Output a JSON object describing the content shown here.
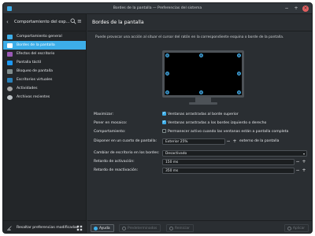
{
  "window": {
    "title": "Bordes de la pantalla — Preferencias del sistema"
  },
  "colors": {
    "accent": "#3daee9",
    "background": "#2a2e32",
    "sidebar": "#232629",
    "text": "#e6e8eb"
  },
  "sidebar": {
    "title": "Comportamiento del esp...",
    "items": [
      {
        "label": "Comportamiento general",
        "icon": "general-behavior-icon"
      },
      {
        "label": "Bordes de la pantalla",
        "icon": "screen-edges-icon",
        "active": true
      },
      {
        "label": "Efectos del escritorio",
        "icon": "desktop-effects-icon"
      },
      {
        "label": "Pantalla táctil",
        "icon": "touchscreen-icon"
      },
      {
        "label": "Bloqueo de pantalla",
        "icon": "lock-icon"
      },
      {
        "label": "Escritorios virtuales",
        "icon": "virtual-desktops-icon"
      },
      {
        "label": "Actividades",
        "icon": "activities-icon"
      },
      {
        "label": "Archivos recientes",
        "icon": "recent-files-icon"
      }
    ],
    "footer_label": "Resaltar preferencias modificadas"
  },
  "main": {
    "title": "Bordes de la pantalla",
    "description": "Puede provocar una acción al situar el cursor del ratón en la correspondiente esquina o borde de la pantalla.",
    "settings": {
      "maximize": {
        "label": "Maximizar:",
        "option": "Ventanas arrastradas al borde superior",
        "checked": true
      },
      "tile": {
        "label": "Poner en mosaico:",
        "option": "Ventanas arrastradas a los bordes izquierdo o derecho",
        "checked": true
      },
      "behavior": {
        "label": "Comportamiento:",
        "option": "Permanecer activo cuando las ventanas están a pantalla completa",
        "checked": false
      },
      "quarter": {
        "label": "Disponer en un cuarto de pantalla:",
        "value": "Exterior 25%",
        "suffix": "externo de la pantalla"
      },
      "desktop_switch": {
        "label": "Cambiar de escritorio en los bordes:",
        "value": "Desactivado"
      },
      "activation_delay": {
        "label": "Retardo de activación:",
        "value": "150 ms"
      },
      "reactivation_delay": {
        "label": "Retardo de reactivación:",
        "value": "350 ms"
      }
    }
  },
  "footer": {
    "help": "Ayuda",
    "defaults": "Predeterminados",
    "reset": "Reiniciar",
    "apply": "Aplicar"
  },
  "icons": {
    "minus": "−",
    "plus": "+",
    "back": "‹",
    "menu": "≡",
    "close": "×",
    "minimize": "−",
    "maximize": "+",
    "chevron": "▾"
  }
}
